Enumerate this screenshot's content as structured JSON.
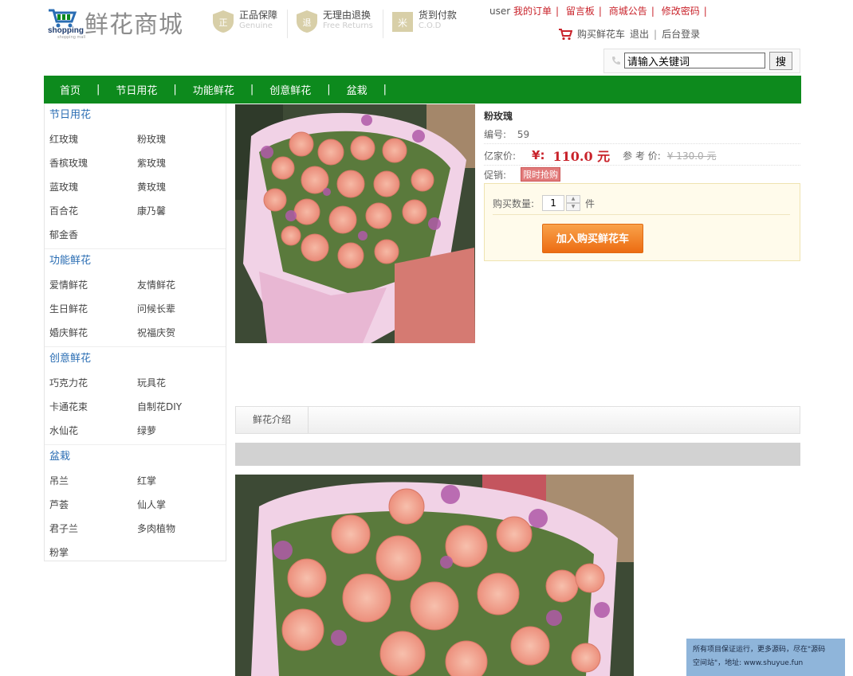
{
  "logo": {
    "brand_en": "shopping",
    "brand_sub": "shopping mall",
    "brand_cn": "鲜花商城"
  },
  "badges": [
    {
      "title": "正品保障",
      "sub": "Genuine"
    },
    {
      "title": "无理由退换",
      "sub": "Free Returns"
    },
    {
      "title": "货到付款",
      "sub": "C.O.D"
    }
  ],
  "topnav": {
    "user": "user",
    "links": [
      "我的订单",
      "留言板",
      "商城公告",
      "修改密码"
    ],
    "cart": "购买鲜花车",
    "logout": "退出",
    "admin": "后台登录"
  },
  "search": {
    "value": "请输入关键词",
    "button": "搜"
  },
  "mainnav": [
    "首页",
    "节日用花",
    "功能鲜花",
    "创意鲜花",
    "盆栽"
  ],
  "sidebar": {
    "categories": [
      {
        "title": "节日用花",
        "items": [
          "红玫瑰",
          "粉玫瑰",
          "香槟玫瑰",
          "紫玫瑰",
          "蓝玫瑰",
          "黄玫瑰",
          "百合花",
          "康乃馨",
          "郁金香"
        ]
      },
      {
        "title": "功能鲜花",
        "items": [
          "爱情鲜花",
          "友情鲜花",
          "生日鲜花",
          "问候长辈",
          "婚庆鲜花",
          "祝福庆贺"
        ]
      },
      {
        "title": "创意鲜花",
        "items": [
          "巧克力花",
          "玩具花",
          "卡通花束",
          "自制花DIY",
          "水仙花",
          "绿萝"
        ]
      },
      {
        "title": "盆栽",
        "items": [
          "吊兰",
          "红掌",
          "芦荟",
          "仙人掌",
          "君子兰",
          "多肉植物",
          "粉掌"
        ]
      }
    ]
  },
  "product": {
    "name": "粉玫瑰",
    "sku_label": "编号:",
    "sku": "59",
    "price_label": "亿家价:",
    "currency": "¥:",
    "price": "110.0 元",
    "ref_label": "参 考 价:",
    "ref_price": "¥ 130.0 元",
    "promo_label": "促销:",
    "promo_tag": "限时抢购",
    "qty_label": "购买数量:",
    "qty_value": "1",
    "qty_unit": "件",
    "add_to_cart": "加入购买鲜花车"
  },
  "tabs": {
    "intro": "鲜花介绍"
  },
  "notice": {
    "line1": "所有项目保证运行，更多源码，尽在\"源码",
    "line2": "空间站\"，地址: www.shuyue.fun"
  },
  "colors": {
    "nav_green": "#0d8a1d",
    "accent_red": "#c9232b",
    "link_blue": "#2a6db3",
    "button_orange": "#ec6c12"
  }
}
